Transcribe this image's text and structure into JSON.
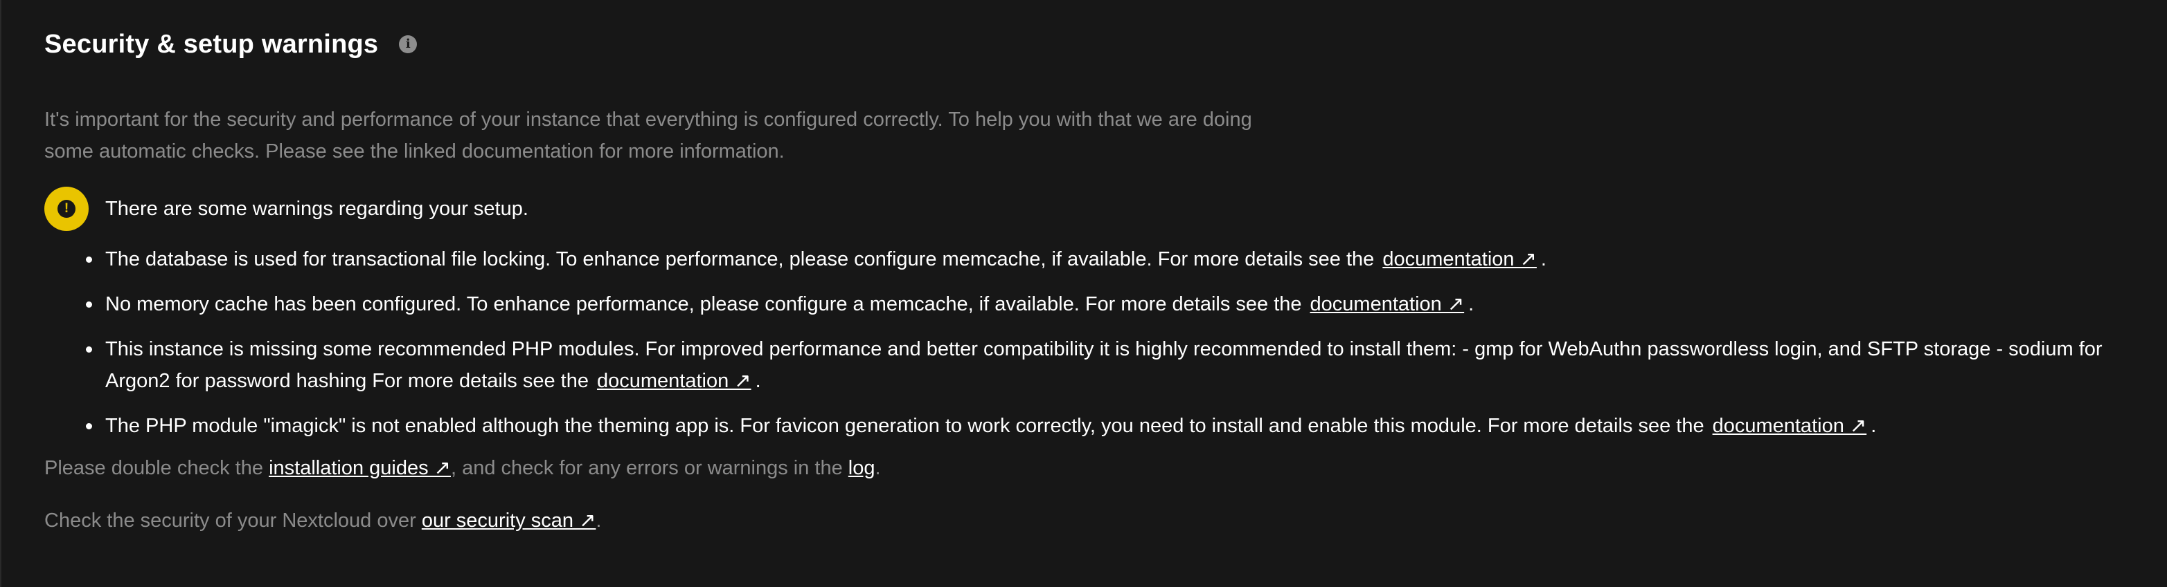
{
  "header": {
    "title": "Security & setup warnings",
    "info_icon": "info-icon"
  },
  "intro": {
    "text": "It's important for the security and performance of your instance that everything is configured correctly. To help you with that we are doing some automatic checks. Please see the linked documentation for more information."
  },
  "status": {
    "icon": "warning-icon",
    "icon_color": "#e9c400",
    "text": "There are some warnings regarding your setup."
  },
  "warnings": [
    {
      "text": "The database is used for transactional file locking. To enhance performance, please configure memcache, if available. For more details see the",
      "link": "documentation ↗",
      "suffix": "."
    },
    {
      "text": "No memory cache has been configured. To enhance performance, please configure a memcache, if available. For more details see the",
      "link": "documentation ↗",
      "suffix": "."
    },
    {
      "text": "This instance is missing some recommended PHP modules. For improved performance and better compatibility it is highly recommended to install them: - gmp for WebAuthn passwordless login, and SFTP storage - sodium for Argon2 for password hashing For more details see the",
      "link": "documentation ↗",
      "suffix": "."
    },
    {
      "text": "The PHP module \"imagick\" is not enabled although the theming app is. For favicon generation to work correctly, you need to install and enable this module. For more details see the",
      "link": "documentation ↗",
      "suffix": "."
    }
  ],
  "footer": {
    "line1_prefix": "Please double check the ",
    "line1_link1": "installation guides ↗",
    "line1_middle": ", and check for any errors or warnings in the ",
    "line1_link2": "log",
    "line1_suffix": ".",
    "line2_prefix": "Check the security of your Nextcloud over ",
    "line2_link": "our security scan ↗",
    "line2_suffix": "."
  }
}
